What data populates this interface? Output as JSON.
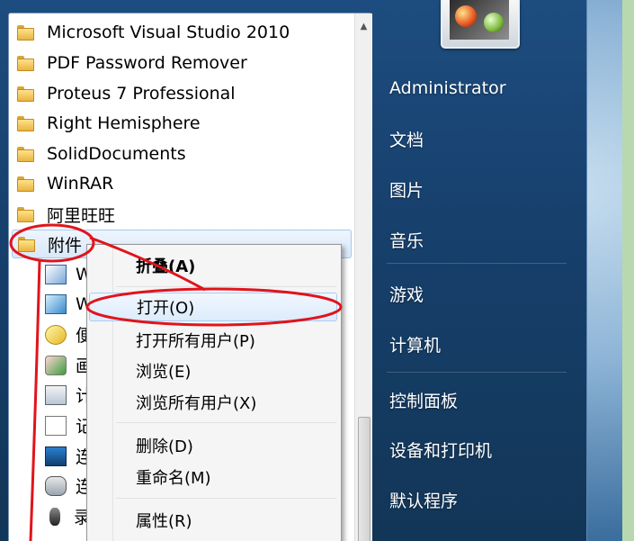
{
  "programs": {
    "items": [
      {
        "label": "Microsoft Visual Studio 2010"
      },
      {
        "label": "PDF Password Remover"
      },
      {
        "label": "Proteus 7 Professional"
      },
      {
        "label": "Right Hemisphere"
      },
      {
        "label": "SolidDocuments"
      },
      {
        "label": "WinRAR"
      },
      {
        "label": "阿里旺旺"
      },
      {
        "label": "附件"
      }
    ],
    "sub_items": [
      {
        "label": "W"
      },
      {
        "label": "W"
      },
      {
        "label": "便"
      },
      {
        "label": "画"
      },
      {
        "label": "计"
      },
      {
        "label": "记"
      },
      {
        "label": "连"
      },
      {
        "label": "连"
      },
      {
        "label": "录"
      }
    ]
  },
  "right_pane": {
    "user": "Administrator",
    "items": [
      "文档",
      "图片",
      "音乐",
      "游戏",
      "计算机",
      "控制面板",
      "设备和打印机",
      "默认程序"
    ]
  },
  "context_menu": {
    "items": [
      {
        "label": "折叠(A)"
      },
      {
        "label": "打开(O)"
      },
      {
        "label": "打开所有用户(P)"
      },
      {
        "label": "浏览(E)"
      },
      {
        "label": "浏览所有用户(X)"
      },
      {
        "label": "删除(D)"
      },
      {
        "label": "重命名(M)"
      },
      {
        "label": "属性(R)"
      }
    ]
  },
  "colors": {
    "annotation": "#e0141c",
    "menu_highlight": "#a8cdf4",
    "start_menu": "#1d4d80"
  }
}
